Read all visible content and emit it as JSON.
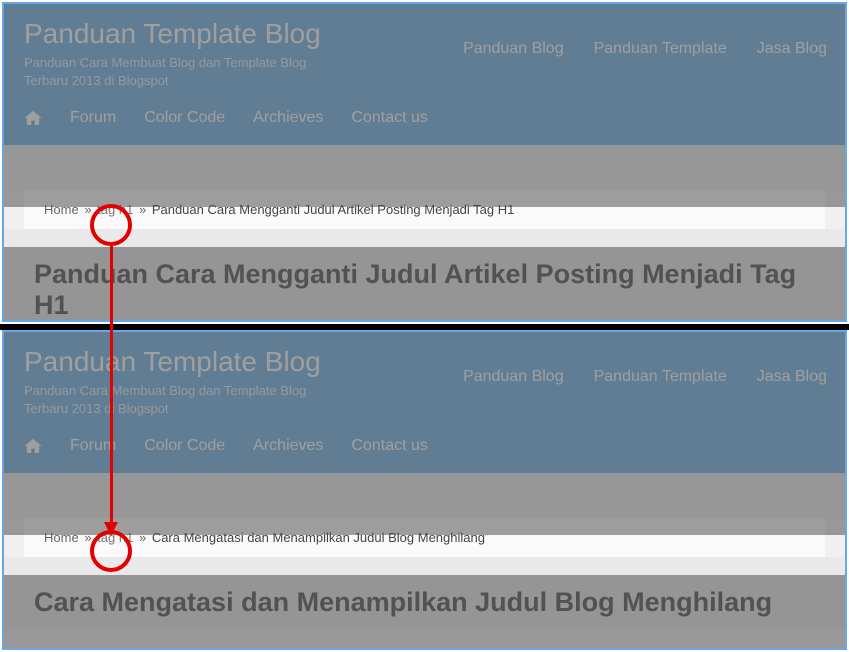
{
  "annotation": {
    "purpose": "compare-breadcrumb-tag-link-between-two-articles",
    "highlight_term": "tag h1",
    "arrow_direction": "top-to-bottom"
  },
  "shared": {
    "site_title": "Panduan Template Blog",
    "tagline": "Panduan Cara Membuat Blog dan Template Blog Terbaru 2013 di Blogspot",
    "topnav": {
      "0": "Panduan Blog",
      "1": "Panduan Template",
      "2": "Jasa Blog"
    },
    "menubar": {
      "0": "Forum",
      "1": "Color Code",
      "2": "Archieves",
      "3": "Contact us"
    },
    "breadcrumb_home": "Home",
    "breadcrumb_tag": "tag h1",
    "breadcrumb_sep": "»"
  },
  "top": {
    "breadcrumb_leaf": "Panduan Cara Mengganti Judul Artikel Posting Menjadi Tag H1",
    "post_title": "Panduan Cara Mengganti Judul Artikel Posting Menjadi Tag H1"
  },
  "bottom": {
    "breadcrumb_leaf": "Cara Mengatasi dan Menampilkan Judul Blog Menghilang",
    "post_title": "Cara Mengatasi dan Menampilkan Judul Blog Menghilang"
  }
}
